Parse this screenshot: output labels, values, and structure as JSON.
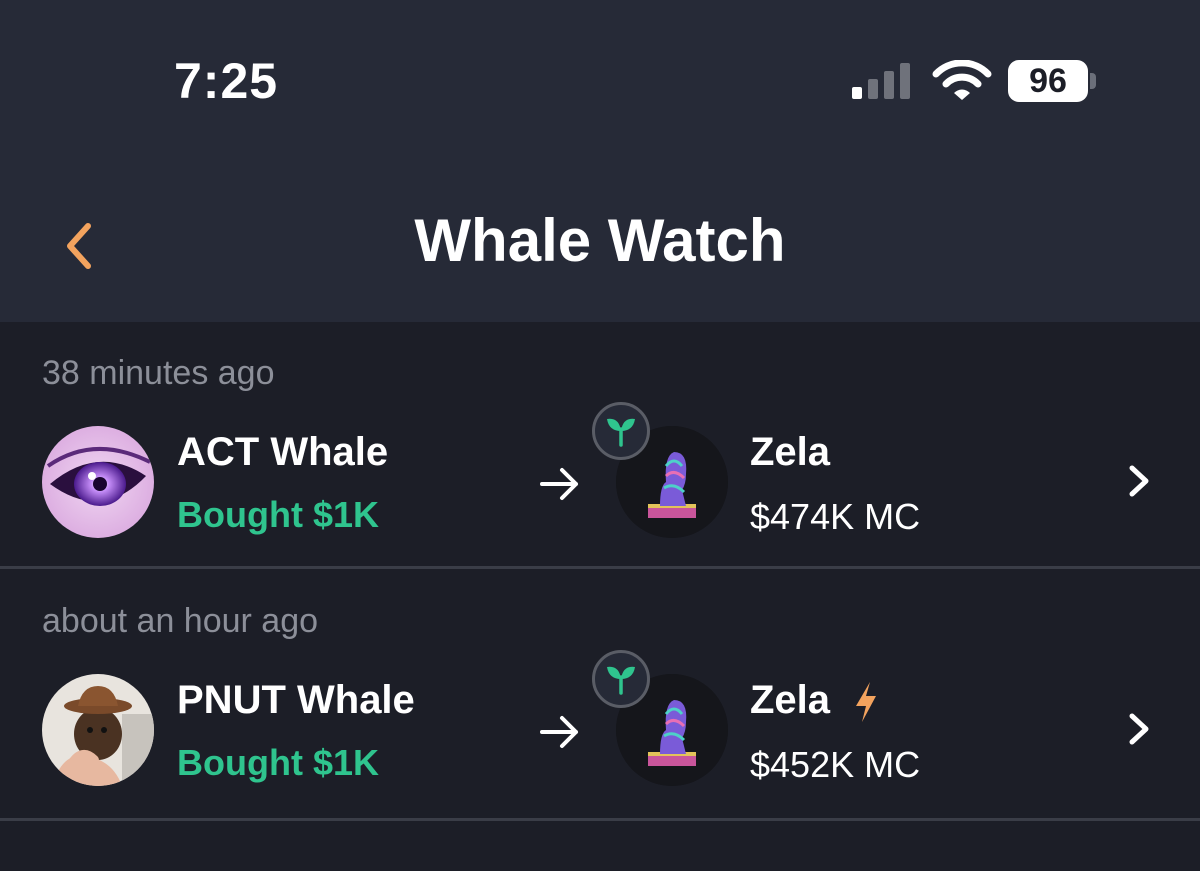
{
  "status_bar": {
    "time": "7:25",
    "battery": "96"
  },
  "header": {
    "title": "Whale Watch"
  },
  "colors": {
    "accent": "#f3a35e",
    "bought": "#2fc48e",
    "background": "#1c1e27",
    "header_bg": "#262a37"
  },
  "feed": [
    {
      "time_ago": "38 minutes ago",
      "whale": "ACT Whale",
      "action": "Bought $1K",
      "token": "Zela",
      "market_cap": "$474K MC",
      "badges": [
        "sprout-icon"
      ]
    },
    {
      "time_ago": "about an hour ago",
      "whale": "PNUT Whale",
      "action": "Bought $1K",
      "token": "Zela",
      "market_cap": "$452K MC",
      "badges": [
        "sprout-icon",
        "lightning-icon"
      ]
    }
  ]
}
